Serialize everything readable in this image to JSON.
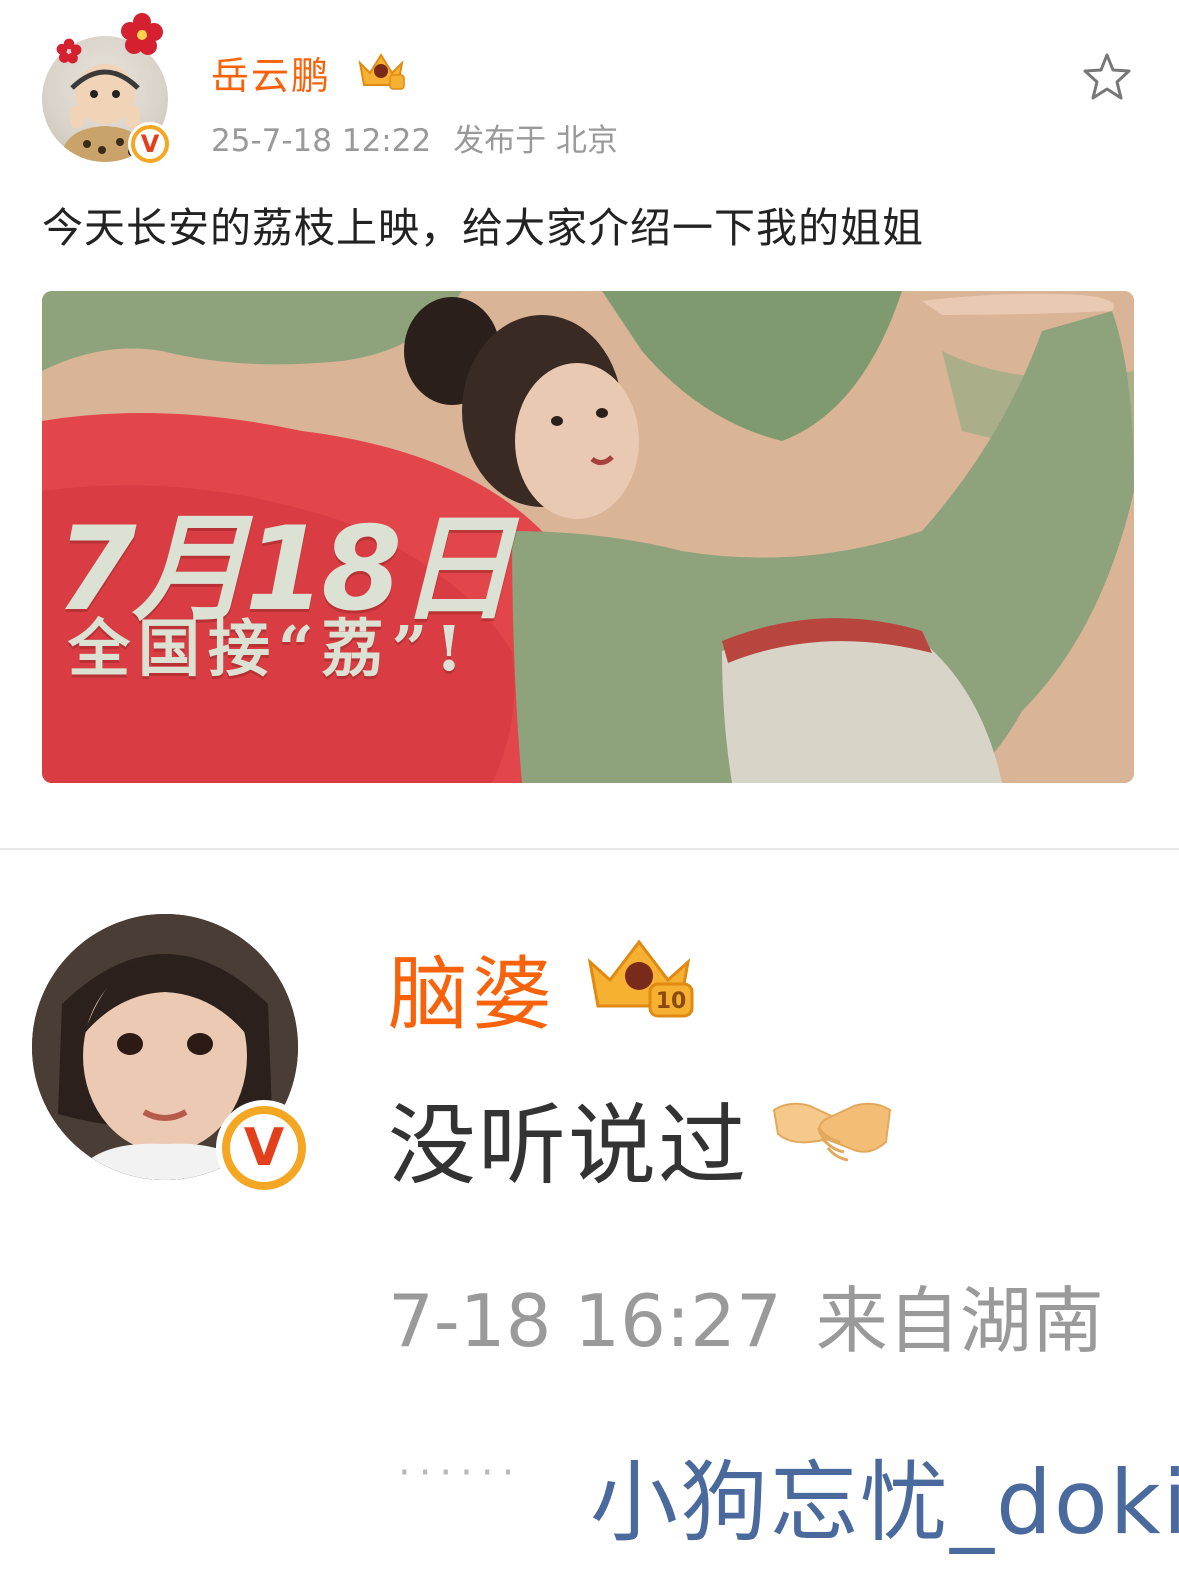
{
  "post": {
    "author": "岳云鹏",
    "time": "25-7-18 12:22",
    "location": "发布于 北京",
    "text": "今天长安的荔枝上映，给大家介绍一下我的姐姐",
    "poster": {
      "date_text": "7月18日",
      "slogan": "全国接“荔”!"
    }
  },
  "comment": {
    "author": "脑婆",
    "text": "没听说过",
    "time": "7-18 16:27",
    "location": "来自湖南",
    "more": "······",
    "reply_user": "小狗忘忧_doki"
  },
  "colors": {
    "username": "#f7620a",
    "meta": "#999999",
    "link": "#4a6a9e",
    "verified": "#f5a623"
  },
  "icons": [
    "star-icon",
    "crown-icon",
    "verified-icon",
    "handshake-emoji"
  ]
}
